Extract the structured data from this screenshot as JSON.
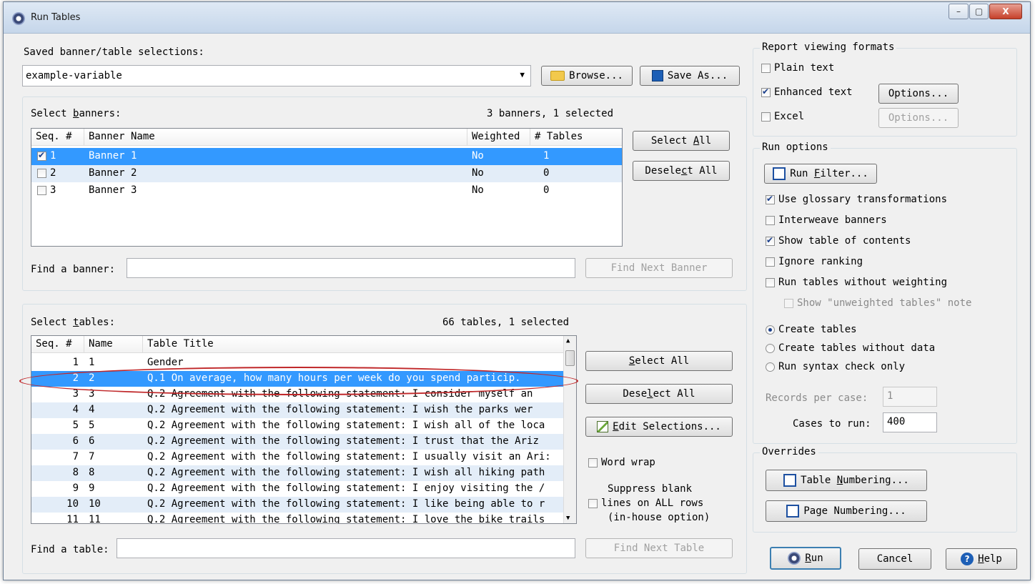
{
  "window": {
    "title": "Run Tables",
    "minimize": "–",
    "maximize": "▢",
    "close": "X"
  },
  "saved": {
    "label": "Saved banner/table selections:",
    "value": "example-variable",
    "browse": "Browse...",
    "save_as": "Save As..."
  },
  "banners": {
    "label_pre": "Select ",
    "label_u": "b",
    "label_post": "anners:",
    "count": "3 banners, 1 selected",
    "headers": [
      "Seq. #",
      "Banner Name",
      "Weighted",
      "# Tables"
    ],
    "rows": [
      {
        "seq": "1",
        "name": "Banner 1",
        "weighted": "No",
        "tables": "1",
        "checked": true
      },
      {
        "seq": "2",
        "name": "Banner 2",
        "weighted": "No",
        "tables": "0",
        "checked": false
      },
      {
        "seq": "3",
        "name": "Banner 3",
        "weighted": "No",
        "tables": "0",
        "checked": false
      }
    ],
    "select_all_pre": "Select ",
    "select_all_u": "A",
    "select_all_post": "ll",
    "deselect_all_pre": "Desele",
    "deselect_all_u": "c",
    "deselect_all_post": "t All",
    "find_label": "Find a banner:",
    "find_next": "Find Next Banner"
  },
  "tables": {
    "label_pre": "Select ",
    "label_u": "t",
    "label_post": "ables:",
    "count": "66 tables, 1 selected",
    "headers": [
      "Seq. #",
      "Name",
      "Table Title"
    ],
    "rows": [
      {
        "seq": "1",
        "name": "1",
        "title": "Gender"
      },
      {
        "seq": "2",
        "name": "2",
        "title": "Q.1 On average, how many hours per week do you spend particip."
      },
      {
        "seq": "3",
        "name": "3",
        "title": "Q.2 Agreement with the following statement: I consider myself an"
      },
      {
        "seq": "4",
        "name": "4",
        "title": "Q.2 Agreement with the following statement: I wish the parks wer"
      },
      {
        "seq": "5",
        "name": "5",
        "title": "Q.2 Agreement with the following statement: I wish all of the loca"
      },
      {
        "seq": "6",
        "name": "6",
        "title": "Q.2 Agreement with the following statement: I trust that the Ariz"
      },
      {
        "seq": "7",
        "name": "7",
        "title": "Q.2 Agreement with the following statement: I usually visit an Ari:"
      },
      {
        "seq": "8",
        "name": "8",
        "title": "Q.2 Agreement with the following statement: I wish all hiking path"
      },
      {
        "seq": "9",
        "name": "9",
        "title": "Q.2 Agreement with the following statement: I enjoy visiting the /"
      },
      {
        "seq": "10",
        "name": "10",
        "title": "Q.2 Agreement with the following statement: I like being able to r"
      },
      {
        "seq": "11",
        "name": "11",
        "title": "Q.2 Agreement with the following statement: I love the bike trails"
      }
    ],
    "select_all_pre": "",
    "select_all_u": "S",
    "select_all_post": "elect All",
    "deselect_all_pre": "Dese",
    "deselect_all_u": "l",
    "deselect_all_post": "ect All",
    "edit_pre": "",
    "edit_u": "E",
    "edit_post": "dit Selections...",
    "word_wrap": "Word wrap",
    "suppress_title": "Suppress blank",
    "suppress_line2": "lines on ALL rows",
    "suppress_line3": "(in-house option)",
    "find_label": "Find a table:",
    "find_next": "Find Next Table"
  },
  "report": {
    "label": "Report viewing formats",
    "plain_text": "Plain text",
    "enhanced_text": "Enhanced text",
    "excel": "Excel",
    "options": "Options..."
  },
  "run_options": {
    "label": "Run options",
    "run_filter_pre": "Run ",
    "run_filter_u": "F",
    "run_filter_post": "ilter...",
    "use_glossary": "Use glossary transformations",
    "interweave": "Interweave banners",
    "show_toc": "Show table of contents",
    "ignore_ranking": "Ignore ranking",
    "no_weighting": "Run tables without weighting",
    "unweighted_note": "Show \"unweighted tables\" note",
    "create_tables": "Create tables",
    "create_without_data": "Create tables without data",
    "syntax_check": "Run syntax check only",
    "records_label": "Records per case:",
    "records_value": "1",
    "cases_label": "Cases to run:",
    "cases_value": "400"
  },
  "overrides": {
    "label": "Overrides",
    "table_numbering_pre": "Table ",
    "table_numbering_u": "N",
    "table_numbering_post": "umbering...",
    "page_numbering": "Page Numbering..."
  },
  "footer": {
    "run_u": "R",
    "run_post": "un",
    "cancel": "Cancel",
    "help_u": "H",
    "help_post": "elp"
  }
}
